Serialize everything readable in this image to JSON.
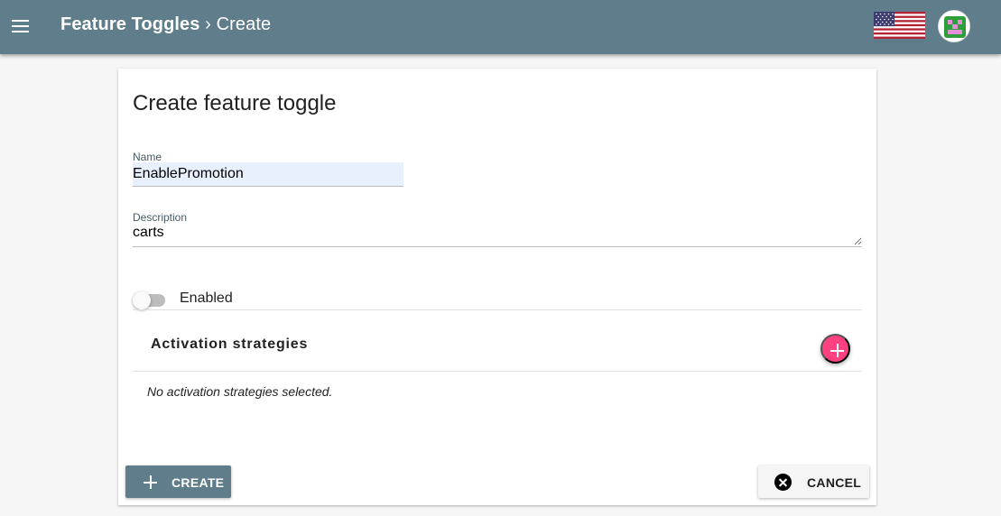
{
  "header": {
    "breadcrumb_root": "Feature Toggles",
    "breadcrumb_separator": " › ",
    "breadcrumb_current": "Create",
    "bar_color": "#607d8b",
    "menu_icon": "hamburger-menu-icon",
    "language_icon": "us-flag-icon",
    "avatar_icon": "identicon-avatar"
  },
  "form": {
    "title": "Create feature toggle",
    "name_label": "Name",
    "name_value": "EnablePromotion",
    "description_label": "Description",
    "description_value": "carts",
    "enabled_label": "Enabled",
    "enabled": false
  },
  "strategies": {
    "title": "Activation strategies",
    "empty_text": "No activation strategies selected.",
    "add_icon": "add-circle-icon",
    "add_color": "#ff4081"
  },
  "actions": {
    "create_label": "CREATE",
    "create_icon": "plus-icon",
    "cancel_label": "CANCEL",
    "cancel_icon": "cancel-circle-icon"
  }
}
